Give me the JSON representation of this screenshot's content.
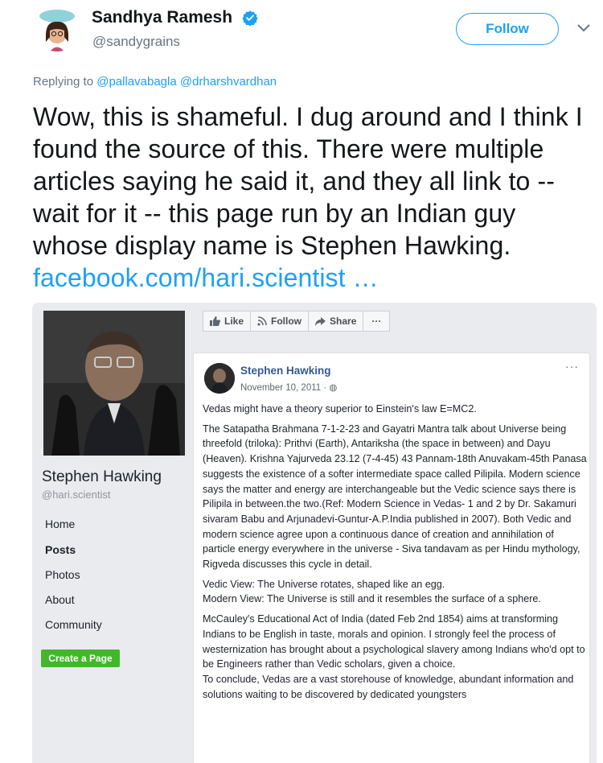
{
  "tweet": {
    "author_name": "Sandhya Ramesh",
    "author_handle": "@sandygrains",
    "follow_label": "Follow",
    "replying_prefix": "Replying to",
    "replying_users": [
      "@pallavabagla",
      "@drharshvardhan"
    ],
    "text": "Wow, this is shameful. I dug around and I think I found the source of this. There were multiple articles saying he said it, and they all link to -- wait for it -- this page run by an Indian guy whose display name is Stephen Hawking.",
    "link_text": "facebook.com/hari.scientist …",
    "colors": {
      "accent": "#1da1f2",
      "verified": "#1da1f2"
    }
  },
  "facebook": {
    "page_name": "Stephen Hawking",
    "page_username": "@hari.scientist",
    "nav": [
      "Home",
      "Posts",
      "Photos",
      "About",
      "Community"
    ],
    "active_nav": "Posts",
    "create_page_label": "Create a Page",
    "actions": [
      "Like",
      "Follow",
      "Share",
      "···"
    ],
    "post": {
      "author": "Stephen Hawking",
      "date": "November 10, 2011 · ◍",
      "more": "···",
      "paragraphs": [
        "Vedas might have a theory superior to Einstein's law E=MC2.",
        "The Satapatha Brahmana 7-1-2-23 and Gayatri Mantra talk about Universe being threefold (triloka): Prithvi (Earth), Antariksha (the space in between) and Dayu (Heaven). Krishna Yajurveda 23.12 (7-4-45) 43 Pannam-18th Anuvakam-45th Panasa suggests the existence of a softer intermediate space called Pilipila. Modern science says the matter and energy are interchangeable but the Vedic science says there is Pilipila in between.the two.(Ref: Modern Science in Vedas- 1 and 2 by Dr. Sakamuri sivaram Babu and Arjunadevi-Guntur-A.P.India published in 2007). Both Vedic and modern science agree upon a continuous dance of creation and annihilation of particle energy everywhere in the universe - Siva tandavam as per Hindu mythology, Rigveda discusses this cycle in detail.",
        "Vedic View: The Universe rotates, shaped like an egg.\nModern View: The Universe is still and it resembles the surface of a sphere.",
        "McCauley's Educational Act of India (dated Feb 2nd 1854) aims at transforming Indians to be English in taste, morals and opinion. I strongly feel the process of westernization has brought about a psychological slavery among Indians who'd opt to be Engineers rather than Vedic scholars, given a choice.\nTo conclude, Vedas are a vast storehouse of knowledge, abundant information and solutions waiting to be discovered by dedicated youngsters"
      ]
    },
    "colors": {
      "link": "#365899",
      "green": "#42b72a",
      "bg": "#e9ebee"
    }
  }
}
